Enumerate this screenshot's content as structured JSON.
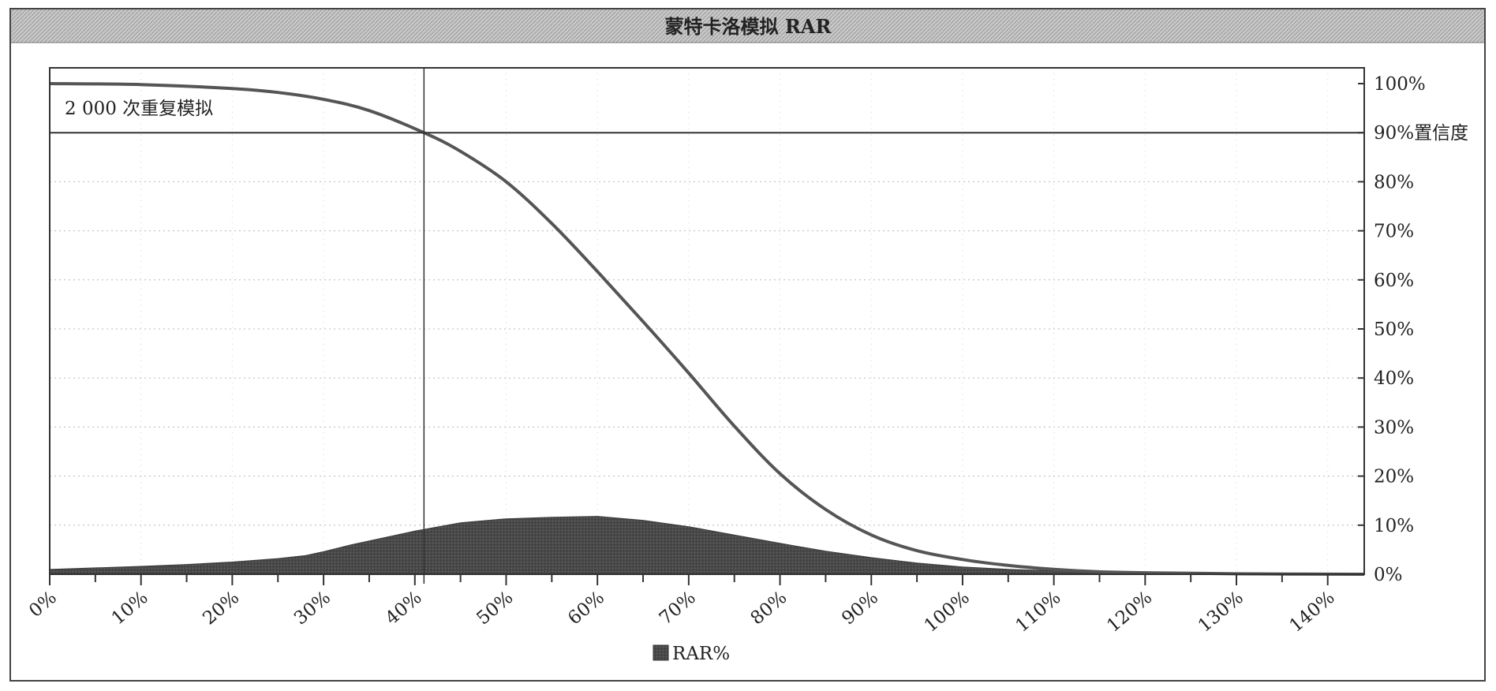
{
  "chart_data": {
    "type": "area",
    "title": "蒙特卡洛模拟 RAR",
    "annotation": "2 000 次重复模拟",
    "confidence_label": "90%置信度",
    "confidence_level": 0.9,
    "confidence_x": 0.41,
    "x_tick_labels": [
      "0%",
      "10%",
      "20%",
      "30%",
      "40%",
      "50%",
      "60%",
      "70%",
      "80%",
      "90%",
      "100%",
      "110%",
      "120%",
      "130%",
      "140%"
    ],
    "y_tick_labels": [
      "100%",
      "90%置信度",
      "80%",
      "70%",
      "60%",
      "50%",
      "40%",
      "30%",
      "20%",
      "10%",
      "0%"
    ],
    "y_tick_values": [
      1.0,
      0.9,
      0.8,
      0.7,
      0.6,
      0.5,
      0.4,
      0.3,
      0.2,
      0.1,
      0.0
    ],
    "xlim": [
      0,
      1.44
    ],
    "ylim": [
      0,
      1.0
    ],
    "legend": {
      "label": "RAR%",
      "position": "bottom-center"
    },
    "series": [
      {
        "name": "RAR%",
        "type": "area",
        "x": [
          0.0,
          0.05,
          0.1,
          0.15,
          0.2,
          0.25,
          0.28,
          0.3,
          0.33,
          0.36,
          0.4,
          0.45,
          0.5,
          0.55,
          0.6,
          0.65,
          0.7,
          0.75,
          0.8,
          0.85,
          0.9,
          0.95,
          1.0,
          1.05,
          1.1,
          1.15,
          1.2,
          1.25,
          1.3,
          1.35,
          1.4,
          1.44
        ],
        "y": [
          0.01,
          0.013,
          0.016,
          0.02,
          0.025,
          0.032,
          0.038,
          0.046,
          0.06,
          0.072,
          0.088,
          0.105,
          0.113,
          0.116,
          0.118,
          0.11,
          0.097,
          0.08,
          0.063,
          0.047,
          0.034,
          0.023,
          0.015,
          0.01,
          0.007,
          0.005,
          0.004,
          0.003,
          0.002,
          0.001,
          0.001,
          0.001
        ]
      },
      {
        "type": "line",
        "x": [
          0.0,
          0.1,
          0.2,
          0.25,
          0.3,
          0.35,
          0.41,
          0.45,
          0.5,
          0.55,
          0.6,
          0.65,
          0.7,
          0.75,
          0.8,
          0.85,
          0.9,
          0.95,
          1.0,
          1.05,
          1.1,
          1.15,
          1.2,
          1.3,
          1.44
        ],
        "y": [
          1.0,
          0.998,
          0.99,
          0.982,
          0.968,
          0.945,
          0.9,
          0.862,
          0.8,
          0.715,
          0.617,
          0.515,
          0.41,
          0.302,
          0.205,
          0.132,
          0.08,
          0.048,
          0.03,
          0.018,
          0.01,
          0.005,
          0.003,
          0.001,
          0.0
        ]
      }
    ]
  }
}
